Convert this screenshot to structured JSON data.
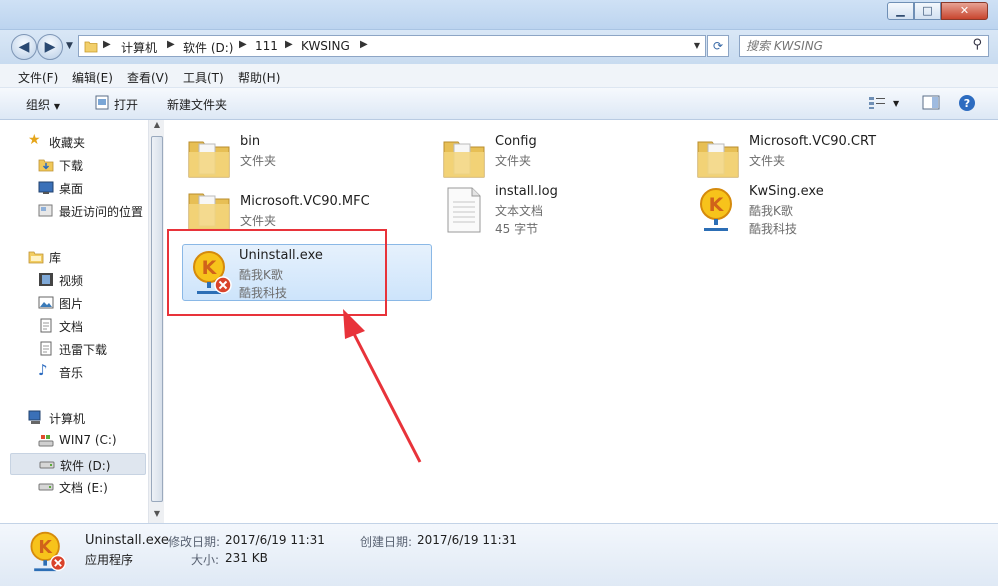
{
  "window": {
    "controls": {
      "minimize": "▁",
      "maximize": "□",
      "close": "✕"
    }
  },
  "navigation": {
    "breadcrumbs": [
      "计算机",
      "软件 (D:)",
      "111",
      "KWSING"
    ],
    "search_placeholder": "搜索 KWSING"
  },
  "menu": [
    "文件(F)",
    "编辑(E)",
    "查看(V)",
    "工具(T)",
    "帮助(H)"
  ],
  "toolbar": {
    "organize": "组织",
    "open": "打开",
    "new_folder": "新建文件夹"
  },
  "sidebar": {
    "favorites": {
      "header": "收藏夹",
      "items": [
        "下载",
        "桌面",
        "最近访问的位置"
      ]
    },
    "libraries": {
      "header": "库",
      "items": [
        "视频",
        "图片",
        "文档",
        "迅雷下载",
        "音乐"
      ]
    },
    "computer": {
      "header": "计算机",
      "items": [
        "WIN7 (C:)",
        "软件 (D:)",
        "文档 (E:)"
      ],
      "selected": "软件 (D:)"
    }
  },
  "files": [
    {
      "name": "bin",
      "line1": "文件夹",
      "line2": "",
      "icon": "folder-icon"
    },
    {
      "name": "Config",
      "line1": "文件夹",
      "line2": "",
      "icon": "folder-icon"
    },
    {
      "name": "Microsoft.VC90.CRT",
      "line1": "文件夹",
      "line2": "",
      "icon": "folder-icon"
    },
    {
      "name": "Microsoft.VC90.MFC",
      "line1": "文件夹",
      "line2": "",
      "icon": "folder-icon"
    },
    {
      "name": "install.log",
      "line1": "文本文档",
      "line2": "45 字节",
      "icon": "text-document-icon"
    },
    {
      "name": "KwSing.exe",
      "line1": "酷我K歌",
      "line2": "酷我科技",
      "icon": "kwsing-app-icon"
    },
    {
      "name": "Uninstall.exe",
      "line1": "酷我K歌",
      "line2": "酷我科技",
      "icon": "uninstall-app-icon",
      "selected": true
    }
  ],
  "details": {
    "name": "Uninstall.exe",
    "type": "应用程序",
    "modified_label": "修改日期:",
    "modified": "2017/6/19 11:31",
    "created_label": "创建日期:",
    "created": "2017/6/19 11:31",
    "size_label": "大小:",
    "size": "231 KB"
  },
  "colors": {
    "annotation": "#e8333a",
    "selection": "#cde4fb",
    "toolbar": "#dde8f5"
  }
}
